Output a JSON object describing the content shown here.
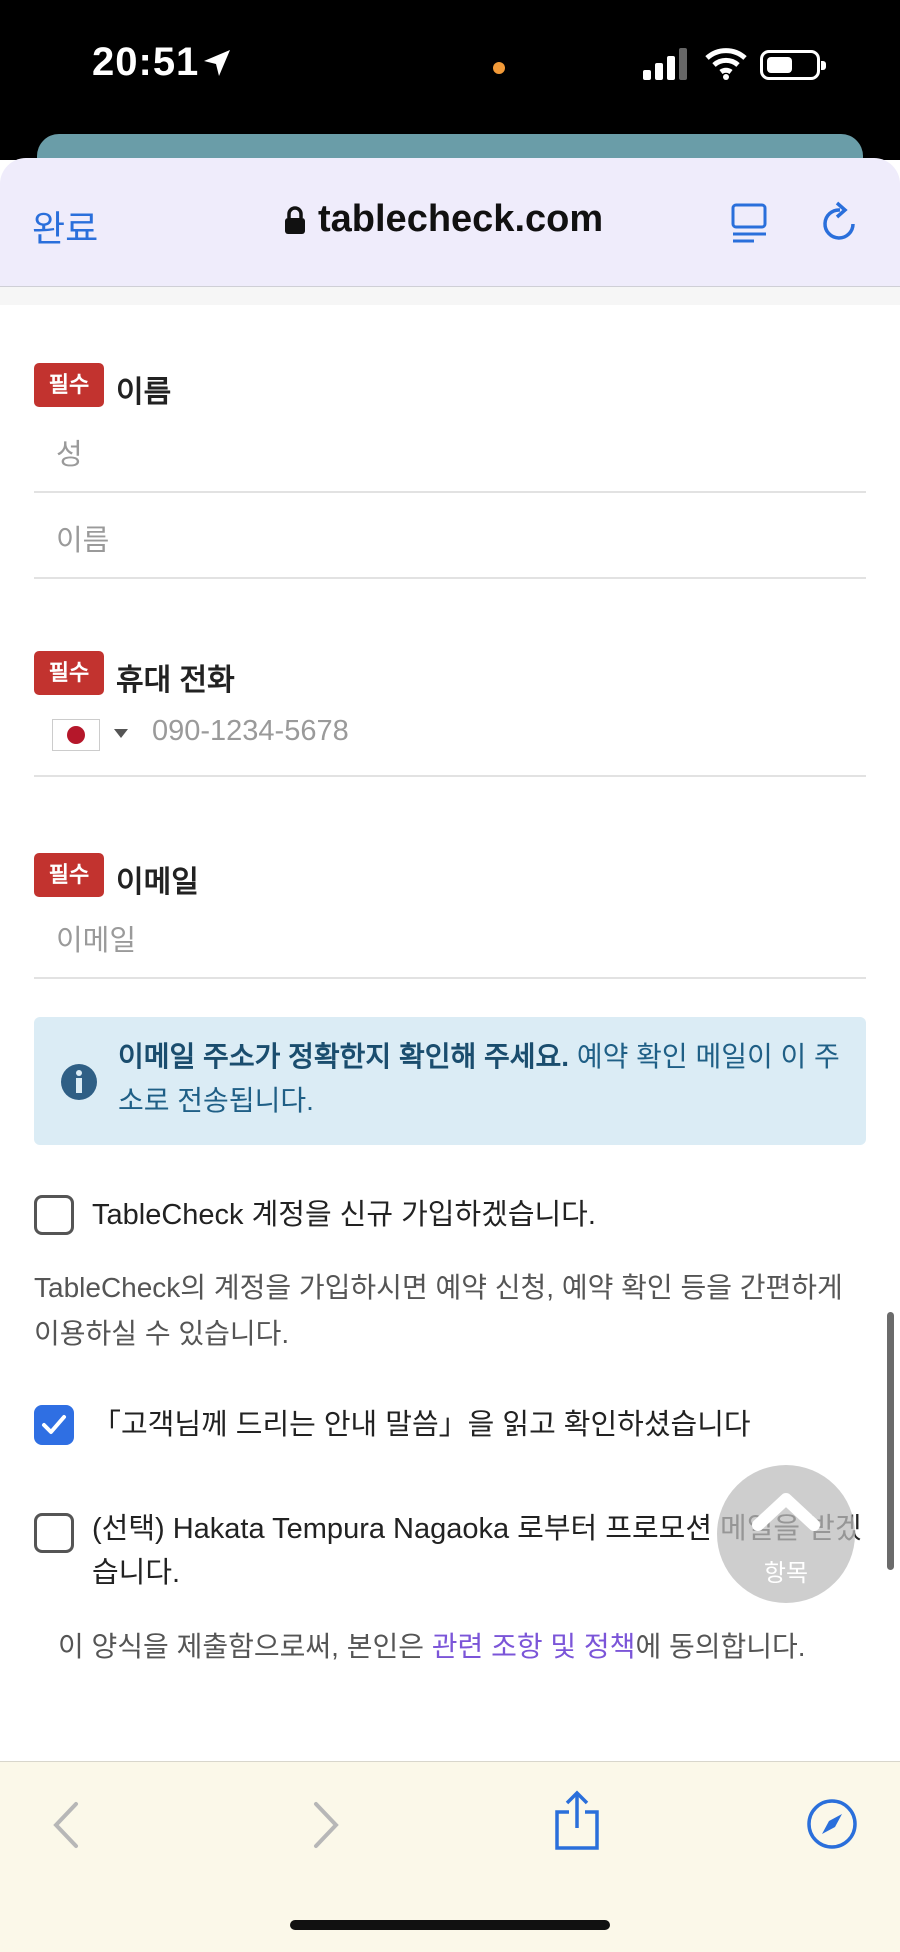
{
  "status": {
    "time": "20:51"
  },
  "browser": {
    "done_label": "완료",
    "url": "tablecheck.com"
  },
  "form": {
    "required_badge": "필수",
    "name_label": "이름",
    "surname_placeholder": "성",
    "given_name_placeholder": "이름",
    "phone_label": "휴대 전화",
    "phone_placeholder": "090-1234-5678",
    "email_label": "이메일",
    "email_placeholder": "이메일"
  },
  "info": {
    "bold": "이메일 주소가 정확한지 확인해 주세요.",
    "text": " 예약 확인 메일이 이 주소로 전송됩니다."
  },
  "checkboxes": [
    {
      "label": "TableCheck 계정을 신규 가입하겠습니다.",
      "checked": false
    },
    {
      "label": "「고객님께 드리는 안내 말씀」을 읽고 확인하셨습니다",
      "checked": true
    },
    {
      "label": "(선택) Hakata Tempura Nagaoka 로부터 프로모션 메일을 받겠습니다.",
      "checked": false
    }
  ],
  "account_desc": "TableCheck의 계정을 가입하시면 예약 신청, 예약 확인 등을 간편하게 이용하실 수 있습니다.",
  "submit_note": {
    "before": "이 양식을 제출함으로써, 본인은 ",
    "link": "관련 조항 및 정책",
    "after": "에 동의합니다."
  },
  "fab": {
    "label": "항목"
  },
  "colors": {
    "required": "#c2332f",
    "link": "#7b55d8",
    "accent": "#2f6fe3",
    "info_bg": "#dbecf5"
  }
}
